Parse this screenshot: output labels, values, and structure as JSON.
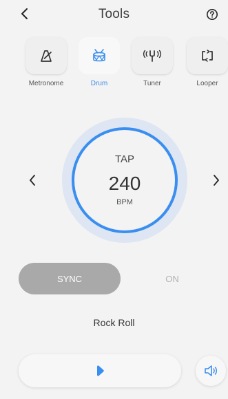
{
  "header": {
    "title": "Tools",
    "back_icon": "chevron-left-icon",
    "help_icon": "question-circle-icon"
  },
  "tools": [
    {
      "id": "metronome",
      "label": "Metronome",
      "icon": "metronome-icon",
      "active": false
    },
    {
      "id": "drum",
      "label": "Drum",
      "icon": "drum-icon",
      "active": true
    },
    {
      "id": "tuner",
      "label": "Tuner",
      "icon": "tuning-fork-icon",
      "active": false
    },
    {
      "id": "looper",
      "label": "Looper",
      "icon": "loop-icon",
      "active": false
    }
  ],
  "tempo": {
    "tap_label": "TAP",
    "bpm": "240",
    "unit": "BPM"
  },
  "sync": {
    "label": "SYNC",
    "state_label": "ON"
  },
  "rhythm": {
    "name": "Rock Roll"
  },
  "controls": {
    "play_icon": "play-icon",
    "sound_icon": "speaker-icon"
  },
  "colors": {
    "accent": "#3a8ef0",
    "active_label": "#3d8bea",
    "ring_halo": "#dde6f2",
    "sync_button": "#a9a9a9",
    "background": "#f3f3f3"
  }
}
